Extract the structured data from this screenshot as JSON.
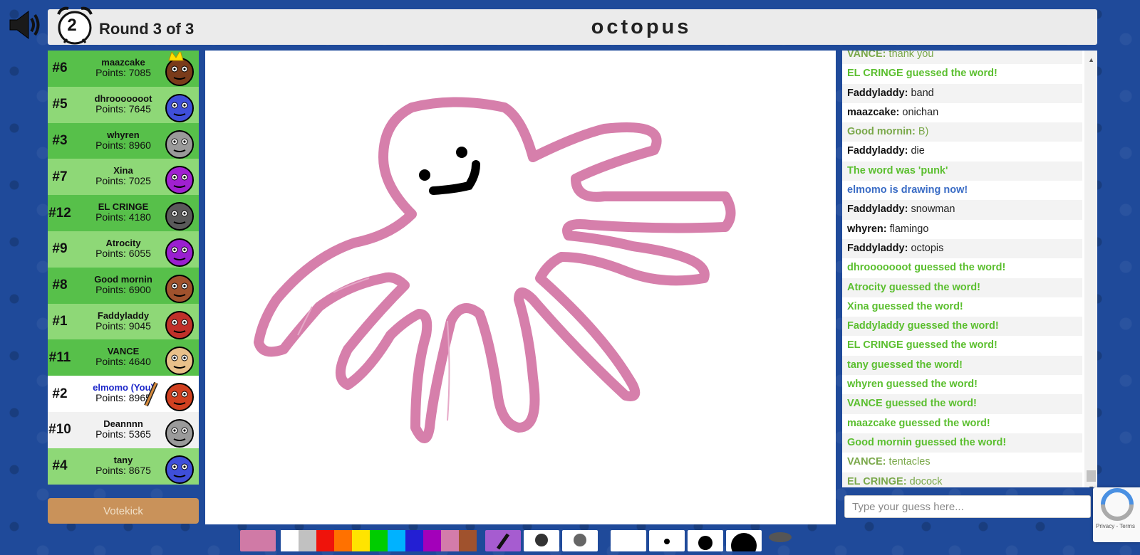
{
  "header": {
    "timer": "2",
    "round": "Round 3 of 3",
    "word": "octopus"
  },
  "players": [
    {
      "rank": "#6",
      "name": "maazcake",
      "points": "Points: 7085",
      "bg": "#57c04a",
      "avatar_color": "#7a3b1a",
      "crown": true
    },
    {
      "rank": "#5",
      "name": "dhrooooooot",
      "points": "Points: 7645",
      "bg": "#8ed877",
      "avatar_color": "#3f4fd9"
    },
    {
      "rank": "#3",
      "name": "whyren",
      "points": "Points: 8960",
      "bg": "#57c04a",
      "avatar_color": "#9a9a9a"
    },
    {
      "rank": "#7",
      "name": "Xina",
      "points": "Points: 7025",
      "bg": "#8ed877",
      "avatar_color": "#a020d0"
    },
    {
      "rank": "#12",
      "name": "EL CRINGE",
      "points": "Points: 4180",
      "bg": "#57c04a",
      "avatar_color": "#5a5a5a"
    },
    {
      "rank": "#9",
      "name": "Atrocity",
      "points": "Points: 6055",
      "bg": "#8ed877",
      "avatar_color": "#9a1fd0"
    },
    {
      "rank": "#8",
      "name": "Good mornin",
      "points": "Points: 6900",
      "bg": "#57c04a",
      "avatar_color": "#a0522d"
    },
    {
      "rank": "#1",
      "name": "Faddyladdy",
      "points": "Points: 9045",
      "bg": "#8ed877",
      "avatar_color": "#c0302a"
    },
    {
      "rank": "#11",
      "name": "VANCE",
      "points": "Points: 4640",
      "bg": "#57c04a",
      "avatar_color": "#e8c08a"
    },
    {
      "rank": "#2",
      "name": "elmomo (You)",
      "points": "Points: 8965",
      "bg": "#ffffff",
      "avatar_color": "#d04020",
      "you": true
    },
    {
      "rank": "#10",
      "name": "Deannnn",
      "points": "Points: 5365",
      "bg": "#f1f1f1",
      "avatar_color": "#9a9a9a"
    },
    {
      "rank": "#4",
      "name": "tany",
      "points": "Points: 8675",
      "bg": "#8ed877",
      "avatar_color": "#3f4fd9"
    }
  ],
  "votekick_label": "Votekick",
  "chat": [
    {
      "who": "VANCE:",
      "text": "thank you",
      "style": "olive"
    },
    {
      "who": "",
      "text": "EL CRINGE guessed the word!",
      "style": "green bold"
    },
    {
      "who": "Faddyladdy:",
      "text": "band",
      "style": ""
    },
    {
      "who": "maazcake:",
      "text": "onichan",
      "style": ""
    },
    {
      "who": "Good mornin:",
      "text": "B)",
      "style": "olive"
    },
    {
      "who": "Faddyladdy:",
      "text": "die",
      "style": ""
    },
    {
      "who": "",
      "text": "The word was 'punk'",
      "style": "green bold"
    },
    {
      "who": "",
      "text": "elmomo is drawing now!",
      "style": "blue"
    },
    {
      "who": "Faddyladdy:",
      "text": "snowman",
      "style": ""
    },
    {
      "who": "whyren:",
      "text": "flamingo",
      "style": ""
    },
    {
      "who": "Faddyladdy:",
      "text": "octopis",
      "style": ""
    },
    {
      "who": "",
      "text": "dhrooooooot guessed the word!",
      "style": "green bold"
    },
    {
      "who": "",
      "text": "Atrocity guessed the word!",
      "style": "green bold"
    },
    {
      "who": "",
      "text": "Xina guessed the word!",
      "style": "green bold"
    },
    {
      "who": "",
      "text": "Faddyladdy guessed the word!",
      "style": "green bold"
    },
    {
      "who": "",
      "text": "EL CRINGE guessed the word!",
      "style": "green bold"
    },
    {
      "who": "",
      "text": "tany guessed the word!",
      "style": "green bold"
    },
    {
      "who": "",
      "text": "whyren guessed the word!",
      "style": "green bold"
    },
    {
      "who": "",
      "text": "VANCE guessed the word!",
      "style": "green bold"
    },
    {
      "who": "",
      "text": "maazcake guessed the word!",
      "style": "green bold"
    },
    {
      "who": "",
      "text": "Good mornin guessed the word!",
      "style": "green bold"
    },
    {
      "who": "VANCE:",
      "text": "tentacles",
      "style": "olive"
    },
    {
      "who": "EL CRINGE:",
      "text": "docock",
      "style": "olive"
    }
  ],
  "guess_placeholder": "Type your guess here...",
  "toolbar": {
    "current_color": "#d07aa6",
    "palette": [
      "#ffffff",
      "#c1c1c1",
      "#ef130b",
      "#ff7100",
      "#ffe400",
      "#00cc00",
      "#00b2ff",
      "#231fd3",
      "#a300ba",
      "#d37caa",
      "#a0522d"
    ]
  },
  "recaptcha_links": "Privacy - Terms",
  "icons": {
    "speaker": "speaker-muted-icon",
    "clock": "alarm-clock-icon",
    "pencil": "pencil-icon",
    "crown": "crown-icon"
  }
}
